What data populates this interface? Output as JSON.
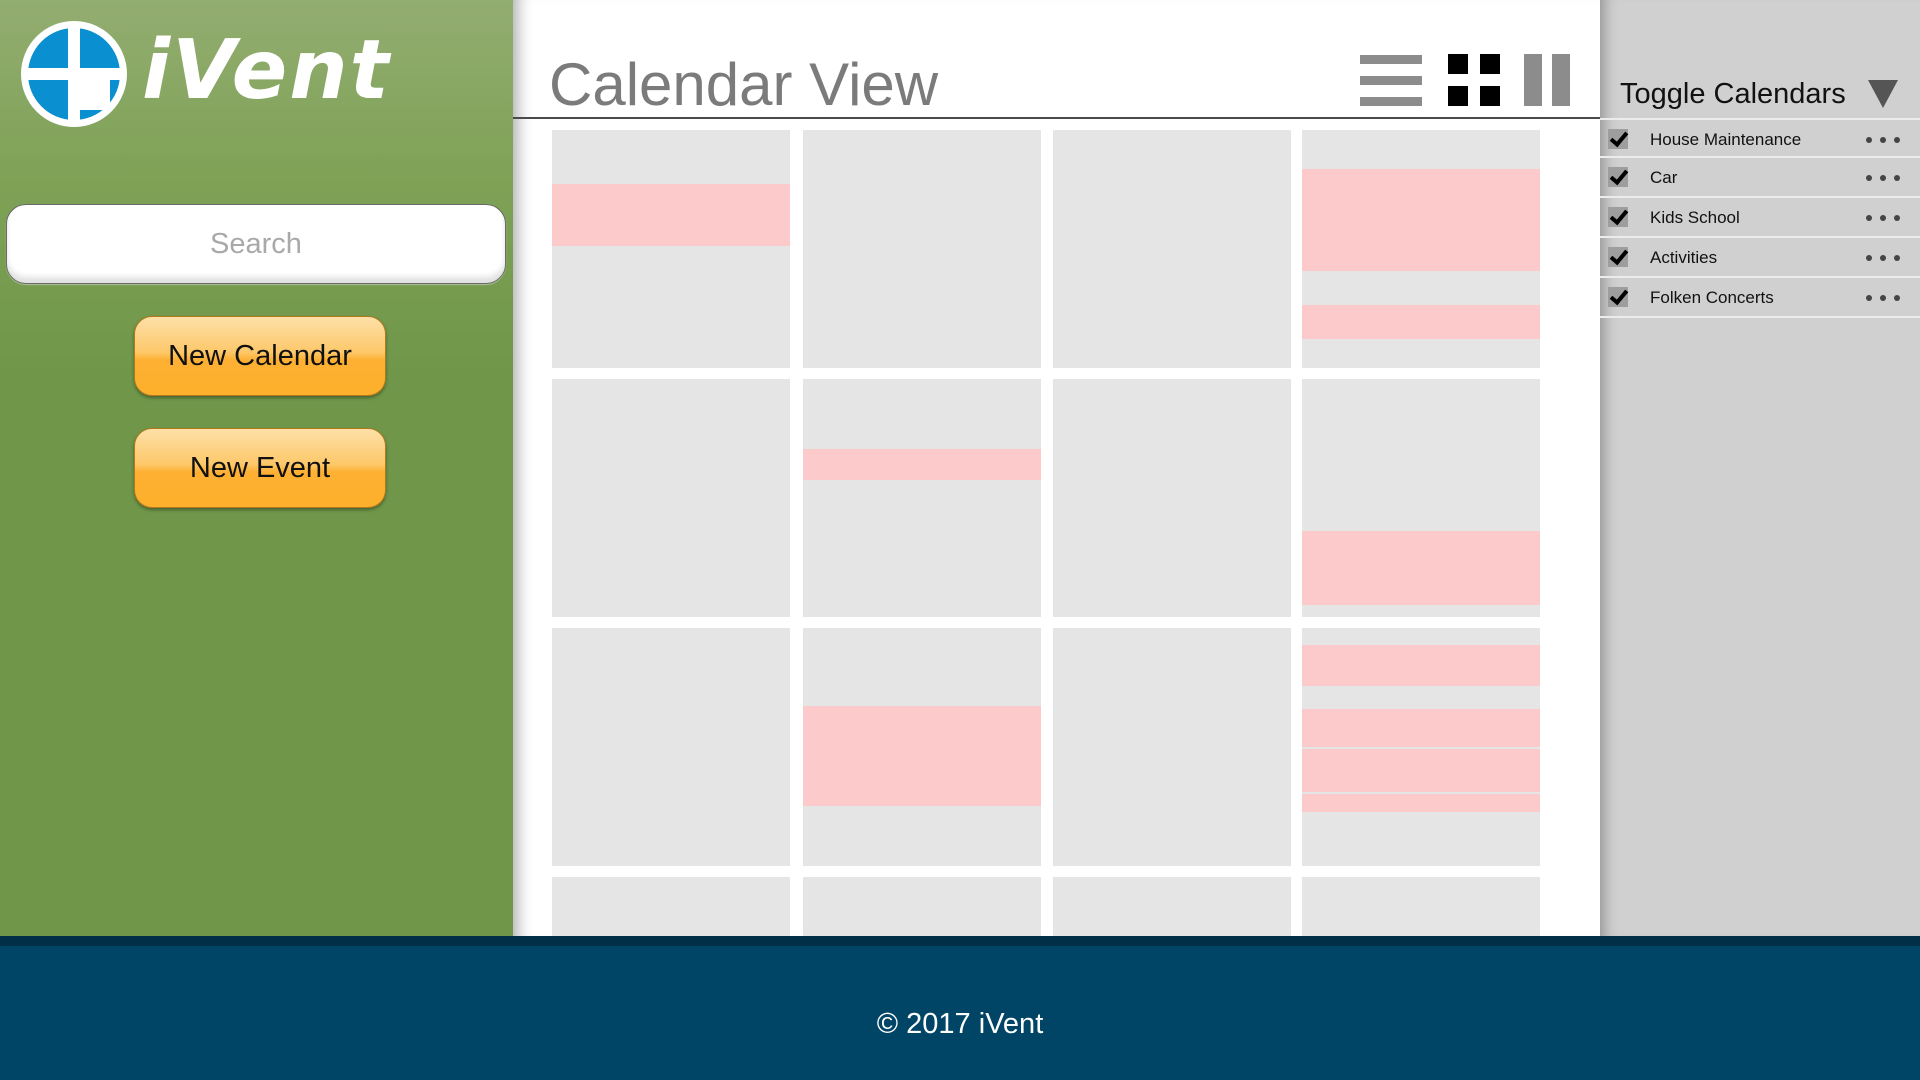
{
  "app": {
    "logo_text": "iVent",
    "logo_icon": "cross-circle-logo"
  },
  "sidebar": {
    "search_placeholder": "Search",
    "new_calendar_label": "New Calendar",
    "new_event_label": "New Event"
  },
  "main": {
    "title": "Calendar View",
    "view_icons": [
      "list-view-icon",
      "grid-view-icon",
      "column-view-icon"
    ]
  },
  "right_panel": {
    "title": "Toggle Calendars",
    "calendars": [
      {
        "label": "House Maintenance",
        "checked": true
      },
      {
        "label": "Car",
        "checked": true
      },
      {
        "label": "Kids School",
        "checked": true
      },
      {
        "label": "Activities",
        "checked": true
      },
      {
        "label": "Folken Concerts",
        "checked": true
      }
    ]
  },
  "footer": {
    "text": "© 2017 iVent"
  },
  "colors": {
    "sidebar_green": "#6f9649",
    "button_orange": "#fcb02b",
    "footer_blue": "#004466",
    "cell_gray": "#e5e5e5",
    "event_pink": "#fccaca",
    "logo_blue": "#0a8fd0"
  }
}
